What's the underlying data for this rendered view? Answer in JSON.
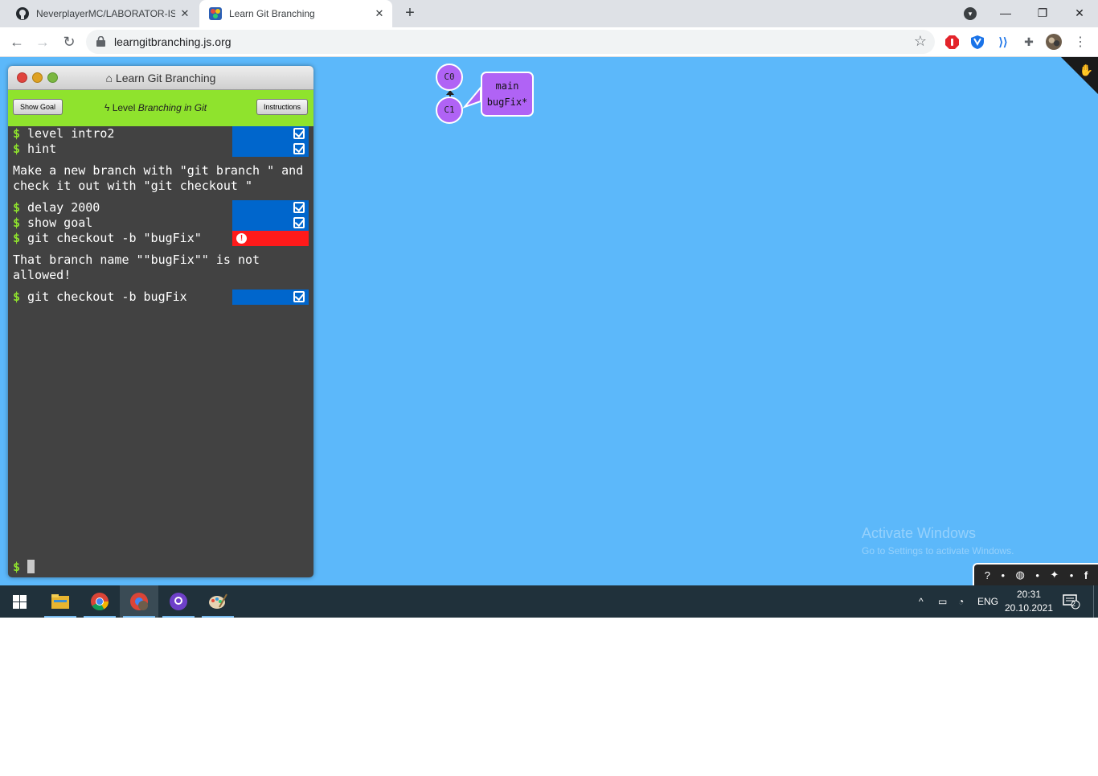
{
  "browser": {
    "tabs": [
      {
        "title": "NeverplayerMC/LABORATOR-ISW",
        "active": false
      },
      {
        "title": "Learn Git Branching",
        "active": true
      }
    ],
    "new_tab": "+",
    "url": "learngitbranching.js.org"
  },
  "terminal": {
    "title": "Learn Git Branching",
    "show_goal": "Show Goal",
    "level_prefix": "Level",
    "level_name": "Branching in Git",
    "instructions": "Instructions",
    "commands": [
      {
        "text": "level intro2",
        "status": "ok"
      },
      {
        "text": "hint",
        "status": "ok"
      }
    ],
    "message1": "Make a new branch with \"git branch \" and\ncheck it out with \"git checkout \"",
    "commands2": [
      {
        "text": "delay 2000",
        "status": "ok"
      },
      {
        "text": "show goal",
        "status": "ok"
      },
      {
        "text": "git checkout -b \"bugFix\"",
        "status": "error"
      }
    ],
    "message2": "That branch name \"\"bugFix\"\" is not\nallowed!",
    "commands3": [
      {
        "text": "git checkout -b bugFix",
        "status": "ok"
      }
    ],
    "prompt": "$"
  },
  "tree": {
    "commits": [
      "C0",
      "C1"
    ],
    "branches": [
      "main",
      "bugFix*"
    ],
    "commit_color": "#b063f5"
  },
  "watermark": {
    "line1": "Activate Windows",
    "line2": "Go to Settings to activate Windows."
  },
  "taskbar": {
    "language": "ENG",
    "time": "20:31",
    "date": "20.10.2021",
    "notifications": "2"
  },
  "colors": {
    "viewport_bg": "#5cb8fa",
    "level_bar": "#8fe32d",
    "status_ok": "#0066cc",
    "status_error": "#ff1a1a"
  }
}
